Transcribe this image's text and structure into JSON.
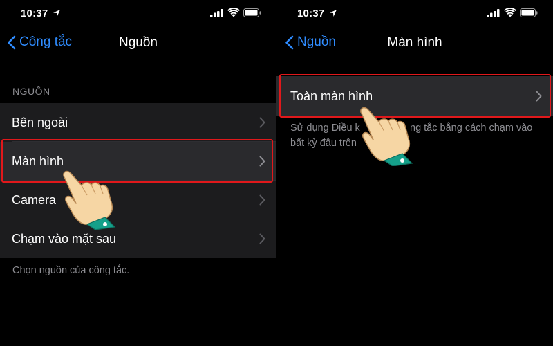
{
  "left_screen": {
    "status": {
      "time": "10:37"
    },
    "nav": {
      "back_label": "Công tắc",
      "title": "Nguồn"
    },
    "section_header": "NGUỒN",
    "items": [
      {
        "label": "Bên ngoài"
      },
      {
        "label": "Màn hình"
      },
      {
        "label": "Camera"
      },
      {
        "label": "Chạm vào mặt sau"
      }
    ],
    "footer": "Chọn nguồn của công tắc."
  },
  "right_screen": {
    "status": {
      "time": "10:37"
    },
    "nav": {
      "back_label": "Nguồn",
      "title": "Màn hình"
    },
    "items": [
      {
        "label": "Toàn màn hình"
      }
    ],
    "footer_line1": "Sử dụng Điều k",
    "footer_line1_end": "ng tắc bằng cách chạm vào",
    "footer_line2": "bất kỳ đâu trên"
  },
  "colors": {
    "background": "#000000",
    "cell_background": "#1c1c1e",
    "accent_blue": "#2f8cff",
    "highlight_red": "#e0181b",
    "secondary_text": "#8d8d92"
  },
  "icons": [
    "location-arrow-icon",
    "signal-icon",
    "wifi-icon",
    "battery-icon",
    "chevron-left-icon",
    "chevron-right-icon",
    "pointing-hand-icon"
  ]
}
